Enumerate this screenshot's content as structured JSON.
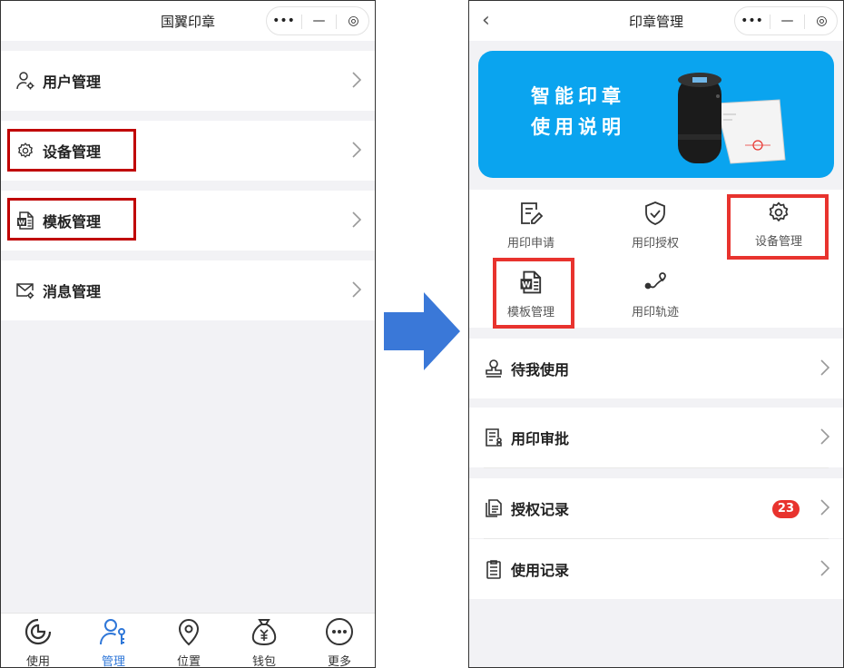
{
  "left_screen": {
    "title": "国翼印章",
    "capsule": {
      "more": "•••",
      "minimize": "—",
      "close": "◎"
    },
    "menu": [
      {
        "label": "用户管理",
        "icon": "user-gear-icon"
      },
      {
        "label": "设备管理",
        "icon": "gear-icon"
      },
      {
        "label": "模板管理",
        "icon": "word-doc-icon"
      },
      {
        "label": "消息管理",
        "icon": "mail-gear-icon"
      }
    ],
    "tabs": [
      {
        "label": "使用",
        "icon": "pie-chart-icon"
      },
      {
        "label": "管理",
        "icon": "user-key-icon",
        "active": true
      },
      {
        "label": "位置",
        "icon": "location-pin-icon"
      },
      {
        "label": "钱包",
        "icon": "money-bag-icon"
      },
      {
        "label": "更多",
        "icon": "more-circle-icon"
      }
    ]
  },
  "right_screen": {
    "title": "印章管理",
    "back": "‹",
    "capsule": {
      "more": "•••",
      "minimize": "—",
      "close": "◎"
    },
    "banner": {
      "line1": "智能印章",
      "line2": "使用说明"
    },
    "grid": [
      {
        "label": "用印申请",
        "icon": "edit-doc-icon"
      },
      {
        "label": "用印授权",
        "icon": "shield-check-icon"
      },
      {
        "label": "设备管理",
        "icon": "gear-icon"
      },
      {
        "label": "模板管理",
        "icon": "word-doc-icon"
      },
      {
        "label": "用印轨迹",
        "icon": "track-icon"
      }
    ],
    "list": [
      {
        "label": "待我使用",
        "icon": "stamp-icon"
      },
      {
        "label": "用印审批",
        "icon": "approval-doc-icon"
      },
      {
        "label": "授权记录",
        "icon": "copy-doc-icon",
        "badge": "23"
      },
      {
        "label": "使用记录",
        "icon": "clipboard-icon"
      }
    ]
  },
  "colors": {
    "highlight_left": "#c00000",
    "highlight_right": "#e8332e",
    "arrow": "#3a78d8",
    "banner": "#0aa4ef",
    "active_tab": "#2f77d8",
    "badge": "#e8332e"
  }
}
